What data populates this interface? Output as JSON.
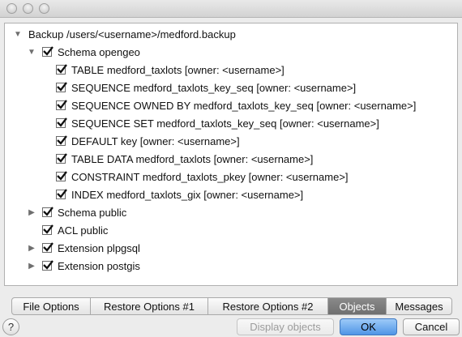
{
  "window": {
    "controls": [
      "close",
      "minimize",
      "zoom"
    ]
  },
  "tree": {
    "root_label": "Backup /users/<username>/medford.backup",
    "items": [
      {
        "label": "Schema opengeo",
        "checked": true,
        "expanded": true
      },
      {
        "label": "TABLE medford_taxlots [owner: <username>]",
        "checked": true
      },
      {
        "label": "SEQUENCE medford_taxlots_key_seq [owner: <username>]",
        "checked": true
      },
      {
        "label": "SEQUENCE OWNED BY medford_taxlots_key_seq [owner: <username>]",
        "checked": true
      },
      {
        "label": "SEQUENCE SET medford_taxlots_key_seq [owner: <username>]",
        "checked": true
      },
      {
        "label": "DEFAULT key [owner: <username>]",
        "checked": true
      },
      {
        "label": "TABLE DATA medford_taxlots [owner: <username>]",
        "checked": true
      },
      {
        "label": "CONSTRAINT medford_taxlots_pkey [owner: <username>]",
        "checked": true
      },
      {
        "label": "INDEX medford_taxlots_gix [owner: <username>]",
        "checked": true
      },
      {
        "label": "Schema public",
        "checked": true,
        "expanded": false
      },
      {
        "label": "ACL public",
        "checked": true
      },
      {
        "label": "Extension plpgsql",
        "checked": true,
        "expanded": false
      },
      {
        "label": "Extension postgis",
        "checked": true,
        "expanded": false
      }
    ]
  },
  "tabs": [
    {
      "label": "File Options",
      "active": false
    },
    {
      "label": "Restore Options #1",
      "active": false
    },
    {
      "label": "Restore Options #2",
      "active": false
    },
    {
      "label": "Objects",
      "active": true
    },
    {
      "label": "Messages",
      "active": false
    }
  ],
  "buttons": {
    "help": "?",
    "display_objects": "Display objects",
    "ok": "OK",
    "cancel": "Cancel"
  },
  "colors": {
    "active_tab": "#7b7b7b",
    "primary_button": "#5a9fe8"
  }
}
